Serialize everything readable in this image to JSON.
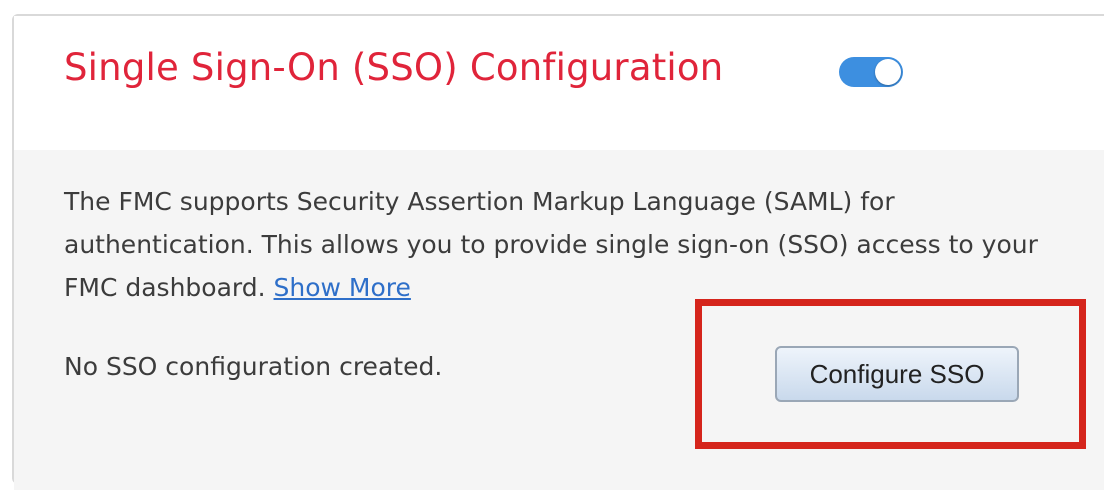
{
  "header": {
    "title": "Single Sign-On (SSO) Configuration",
    "toggle_state": "on"
  },
  "description": {
    "text": "The FMC supports Security Assertion Markup Language (SAML) for authentication. This allows you to provide single sign-on (SSO) access to your FMC dashboard.",
    "link_label": "Show More"
  },
  "status": {
    "text": "No SSO configuration created."
  },
  "actions": {
    "configure_label": "Configure SSO"
  },
  "colors": {
    "title": "#e0243a",
    "toggle": "#3d8fe0",
    "link": "#2e6fc9",
    "highlight": "#d5251c"
  }
}
